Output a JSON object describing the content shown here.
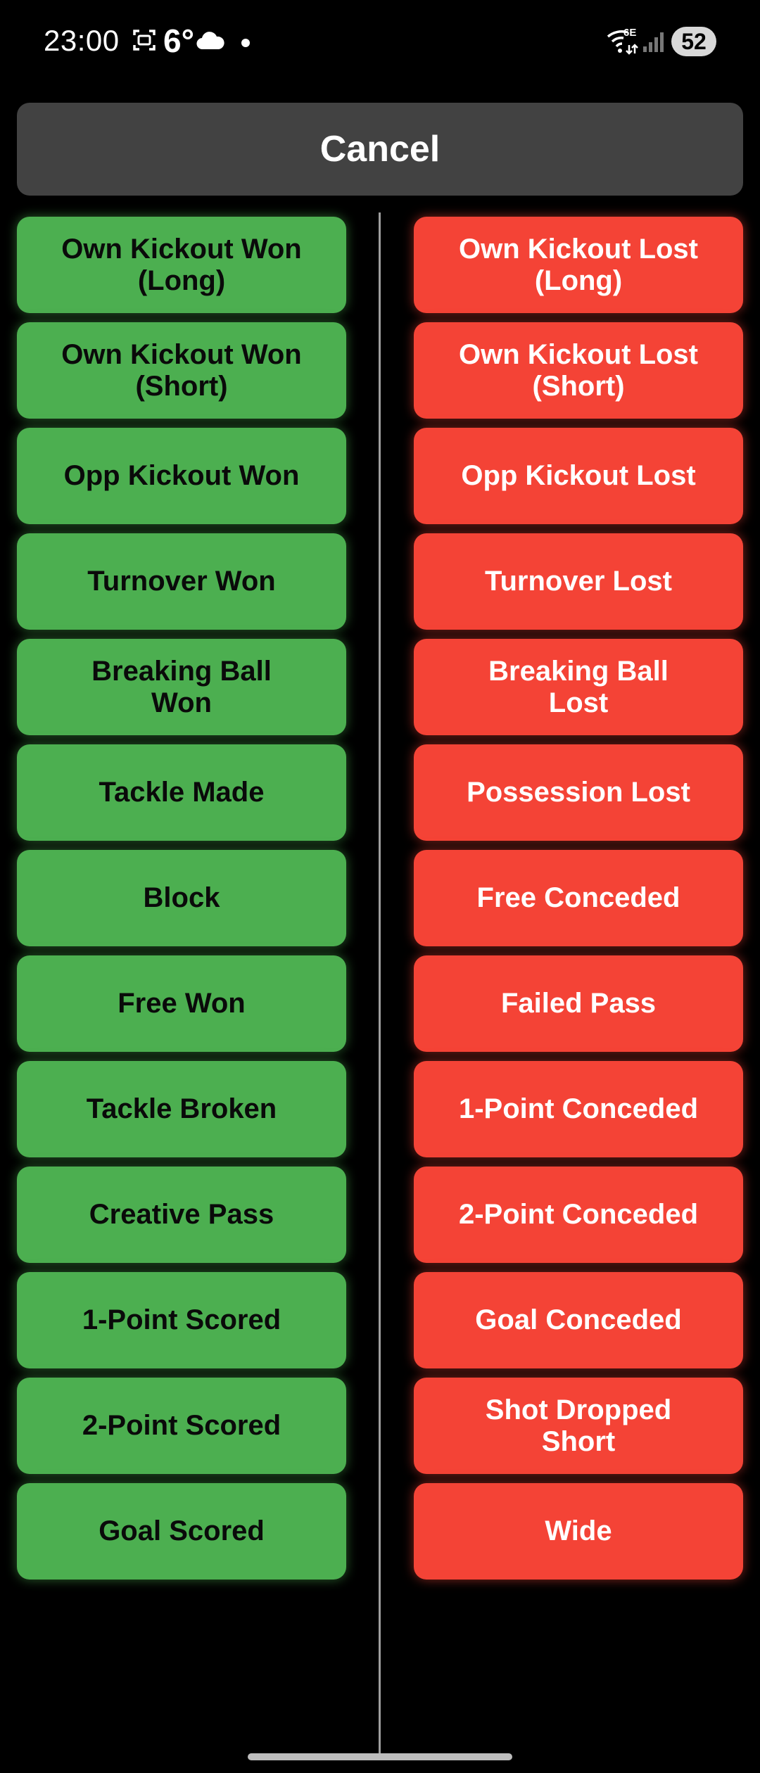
{
  "status_bar": {
    "time": "23:00",
    "temperature": "6°",
    "wifi_label": "6E",
    "battery": "52",
    "icons": [
      "screenshot-icon",
      "cloud-icon",
      "notification-dot-icon",
      "wifi-icon",
      "signal-icon",
      "battery-icon"
    ]
  },
  "cancel": {
    "label": "Cancel"
  },
  "won_actions": [
    {
      "label": "Own Kickout Won\n(Long)"
    },
    {
      "label": "Own Kickout Won\n(Short)"
    },
    {
      "label": "Opp Kickout Won"
    },
    {
      "label": "Turnover Won"
    },
    {
      "label": "Breaking Ball\nWon"
    },
    {
      "label": "Tackle Made"
    },
    {
      "label": "Block"
    },
    {
      "label": "Free Won"
    },
    {
      "label": "Tackle Broken"
    },
    {
      "label": "Creative Pass"
    },
    {
      "label": "1-Point Scored"
    },
    {
      "label": "2-Point Scored"
    },
    {
      "label": "Goal Scored"
    }
  ],
  "lost_actions": [
    {
      "label": "Own Kickout Lost\n(Long)"
    },
    {
      "label": "Own Kickout Lost\n(Short)"
    },
    {
      "label": "Opp Kickout Lost"
    },
    {
      "label": "Turnover Lost"
    },
    {
      "label": "Breaking Ball\nLost"
    },
    {
      "label": "Possession Lost"
    },
    {
      "label": "Free Conceded"
    },
    {
      "label": "Failed Pass"
    },
    {
      "label": "1-Point Conceded"
    },
    {
      "label": "2-Point Conceded"
    },
    {
      "label": "Goal Conceded"
    },
    {
      "label": "Shot Dropped\nShort"
    },
    {
      "label": "Wide"
    }
  ],
  "colors": {
    "background": "#000000",
    "won": "#4caf50",
    "lost": "#f44336",
    "cancel": "#424242"
  }
}
